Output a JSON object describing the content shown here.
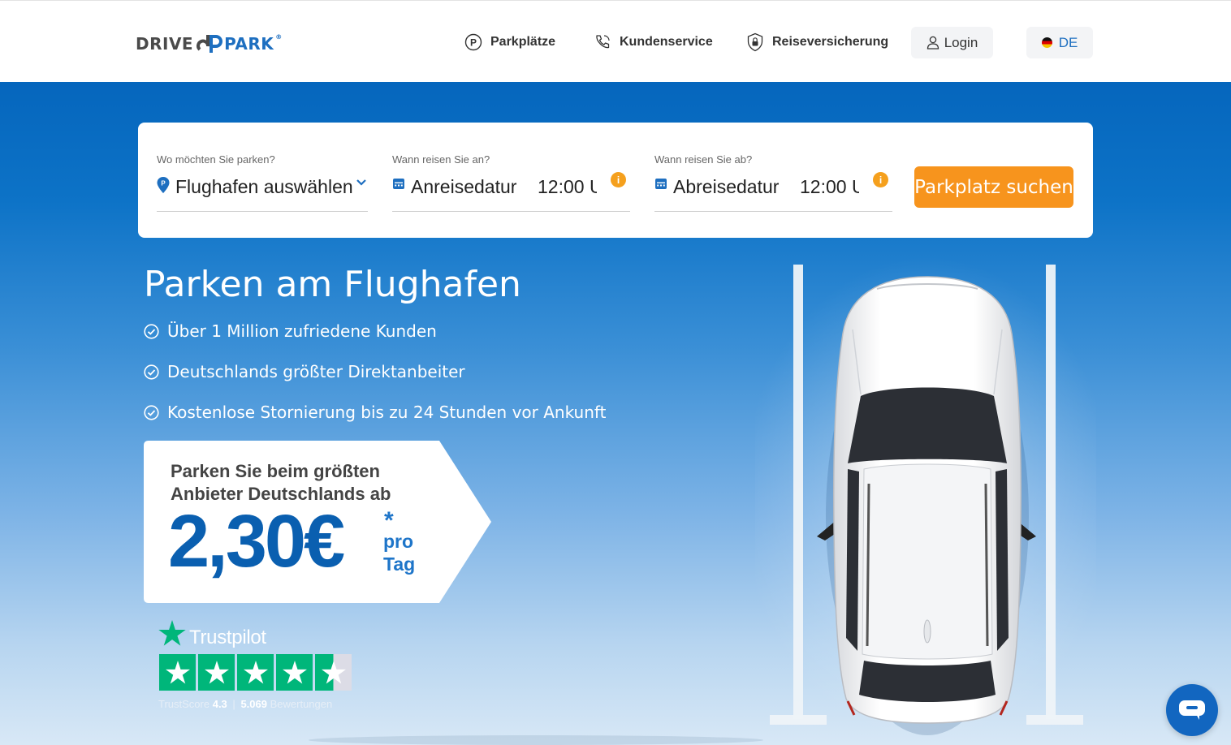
{
  "header": {
    "logo": {
      "part1": "DRIVE",
      "part2": "PARK",
      "reg": "®"
    },
    "nav": [
      {
        "label": "Parkplätze",
        "icon": "parking-icon"
      },
      {
        "label": "Kundenservice",
        "icon": "phone-icon"
      },
      {
        "label": "Reiseversicherung",
        "icon": "shield-lock-icon"
      }
    ],
    "login_label": "Login",
    "language_label": "DE"
  },
  "search": {
    "airport": {
      "label": "Wo möchten Sie parken?",
      "value": "Flughafen auswählen"
    },
    "arrival": {
      "label": "Wann reisen Sie an?",
      "value": "Anreisedatur",
      "time": "12:00 U"
    },
    "departure": {
      "label": "Wann reisen Sie ab?",
      "value": "Abreisedatur",
      "time": "12:00 U"
    },
    "info_glyph": "i",
    "button_label": "Parkplatz suchen"
  },
  "hero": {
    "title": "Parken am Flughafen",
    "benefits": [
      "Über 1 Million zufriedene Kunden",
      "Deutschlands größter Direktanbeiter",
      "Kostenlose Stornierung bis zu 24 Stunden vor Ankunft"
    ],
    "price": {
      "line1": "Parken Sie beim größten",
      "line2": "Anbieter Deutschlands ab",
      "amount": "2,30€",
      "star": "*",
      "unit_line1": "pro",
      "unit_line2": "Tag"
    }
  },
  "trustpilot": {
    "name": "Trustpilot",
    "score_label": "TrustScore",
    "score": "4.3",
    "separator": "|",
    "reviews_count": "5.069",
    "reviews_label": "Bewertungen",
    "rating_stars": 4.5
  },
  "colors": {
    "brand_blue": "#1e6fc0",
    "accent_orange": "#f7941d",
    "trustpilot_green": "#00b67a"
  }
}
